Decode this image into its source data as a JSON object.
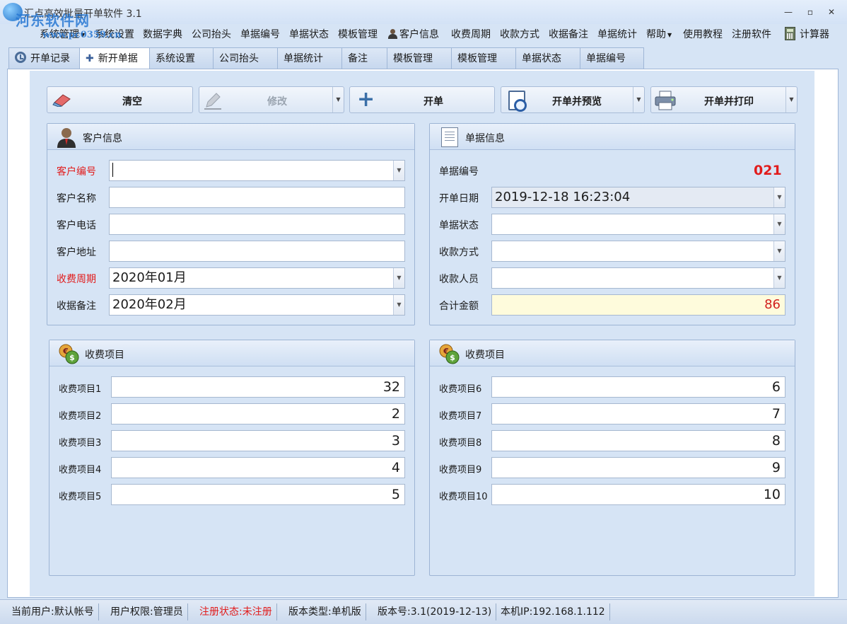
{
  "window": {
    "title": "汇点高效批量开单软件 3.1",
    "watermark": "河东软件网",
    "watermark_url": "www.pc0359.cn",
    "minimize": "—",
    "maximize": "▫",
    "close": "✕"
  },
  "menu": {
    "items": [
      "系统管理",
      "系统设置",
      "数据字典",
      "公司抬头",
      "单据编号",
      "单据状态",
      "模板管理",
      "客户信息",
      "收费周期",
      "收款方式",
      "收据备注",
      "单据统计",
      "帮助",
      "使用教程",
      "注册软件",
      "计算器"
    ]
  },
  "tabs": [
    "开单记录",
    "新开单据",
    "系统设置",
    "公司抬头",
    "单据统计",
    "备注",
    "模板管理",
    "模板管理",
    "单据状态",
    "单据编号"
  ],
  "toolbar": {
    "clear": "清空",
    "modify": "修改",
    "open": "开单",
    "open_preview": "开单并预览",
    "open_print": "开单并打印"
  },
  "customer": {
    "title": "客户信息",
    "labels": [
      "客户编号",
      "客户名称",
      "客户电话",
      "客户地址",
      "收费周期",
      "收据备注"
    ],
    "values": [
      "",
      "",
      "",
      "",
      "2020年01月",
      "2020年02月"
    ]
  },
  "bill": {
    "title": "单据信息",
    "number_label": "单据编号",
    "number": "021",
    "labels": [
      "开单日期",
      "单据状态",
      "收款方式",
      "收款人员",
      "合计金额"
    ],
    "values": [
      "2019-12-18 16:23:04",
      "",
      "",
      "",
      "86"
    ]
  },
  "fees_left": {
    "title": "收费项目",
    "labels": [
      "收费项目1",
      "收费项目2",
      "收费项目3",
      "收费项目4",
      "收费项目5"
    ],
    "values": [
      "32",
      "2",
      "3",
      "4",
      "5"
    ]
  },
  "fees_right": {
    "title": "收费项目",
    "labels": [
      "收费项目6",
      "收费项目7",
      "收费项目8",
      "收费项目9",
      "收费项目10"
    ],
    "values": [
      "6",
      "7",
      "8",
      "9",
      "10"
    ]
  },
  "status": {
    "user": "当前用户:默认帐号",
    "permission": "用户权限:管理员",
    "registration": "注册状态:未注册",
    "version_type": "版本类型:单机版",
    "version": "版本号:3.1(2019-12-13)",
    "ip": "本机IP:192.168.1.112"
  },
  "colors": {
    "accent_red": "#e11c1c",
    "panel_bg": "#d6e4f5",
    "total_bg": "#fefbdc"
  }
}
